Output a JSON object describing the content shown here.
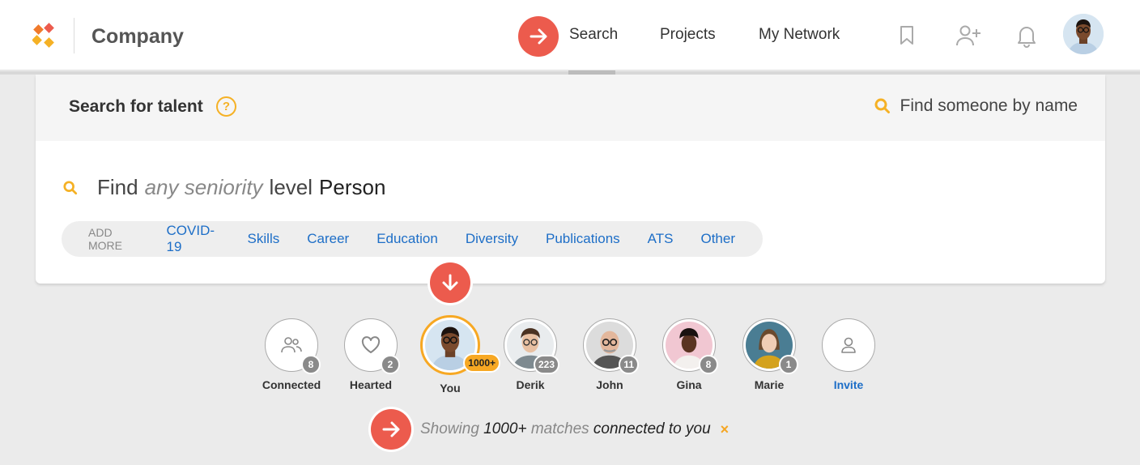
{
  "header": {
    "brand": "Company",
    "nav": [
      {
        "label": "Search"
      },
      {
        "label": "Projects"
      },
      {
        "label": "My Network"
      }
    ]
  },
  "panel": {
    "title": "Search for talent",
    "help": "?",
    "find_by_name": "Find someone by name",
    "query": {
      "find": "Find",
      "seniority": "any seniority",
      "level": "level",
      "subject": "Person"
    },
    "chips_label": "ADD MORE",
    "chips": [
      "COVID-19",
      "Skills",
      "Career",
      "Education",
      "Diversity",
      "Publications",
      "ATS",
      "Other"
    ]
  },
  "people": [
    {
      "name": "Connected",
      "count": "8",
      "icon": "connected-people-icon"
    },
    {
      "name": "Hearted",
      "count": "2",
      "icon": "heart-icon"
    },
    {
      "name": "You",
      "count": "1000+"
    },
    {
      "name": "Derik",
      "count": "223"
    },
    {
      "name": "John",
      "count": "11"
    },
    {
      "name": "Gina",
      "count": "8"
    },
    {
      "name": "Marie",
      "count": "1"
    },
    {
      "name": "Invite",
      "icon": "person-icon"
    }
  ],
  "status": {
    "showing": "Showing",
    "count": "1000+",
    "matches": "matches",
    "connected": "connected to you",
    "clear": "×"
  },
  "colors": {
    "accent": "#f5b125",
    "arrow": "#ec5b4d",
    "link": "#1d6ec7"
  }
}
